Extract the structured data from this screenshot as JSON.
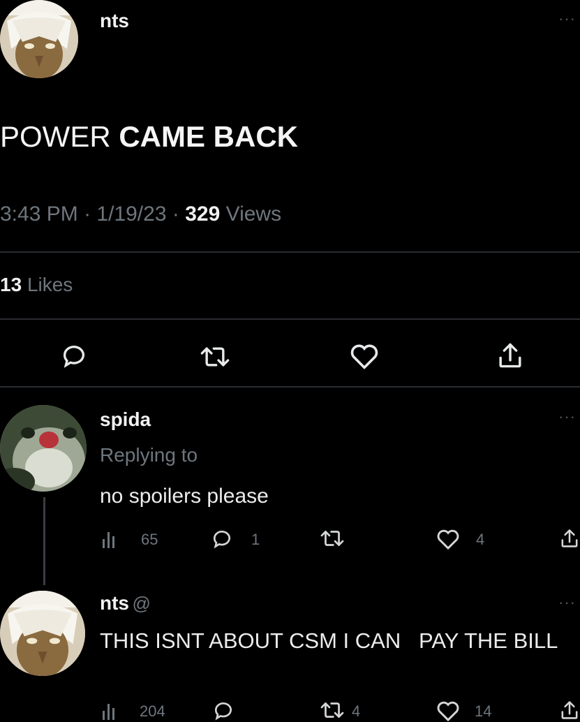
{
  "main_tweet": {
    "author": "nts",
    "text_light": "POWER",
    "text_bold": "CAME BACK",
    "time": "3:43 PM",
    "date": "1/19/23",
    "sep": "·",
    "views_count": "329",
    "views_label": "Views",
    "likes_count": "13",
    "likes_label": "Likes"
  },
  "reply_1": {
    "author": "spida",
    "replying_to": "Replying to",
    "text": "no spoilers please",
    "views": "65",
    "replies": "1",
    "likes": "4"
  },
  "reply_2": {
    "author": "nts",
    "handle_prefix": "@",
    "text": "THIS ISNT ABOUT CSM I CAN   PAY THE BILL",
    "views": "204",
    "retweets": "4",
    "likes": "14"
  },
  "icons": [
    "reply-icon",
    "retweet-icon",
    "like-icon",
    "share-icon",
    "views-icon",
    "more-icon"
  ],
  "colors": {
    "background": "#000000",
    "text": "#e7e9ea",
    "muted": "#6e767d",
    "divider": "#2a2d31"
  }
}
